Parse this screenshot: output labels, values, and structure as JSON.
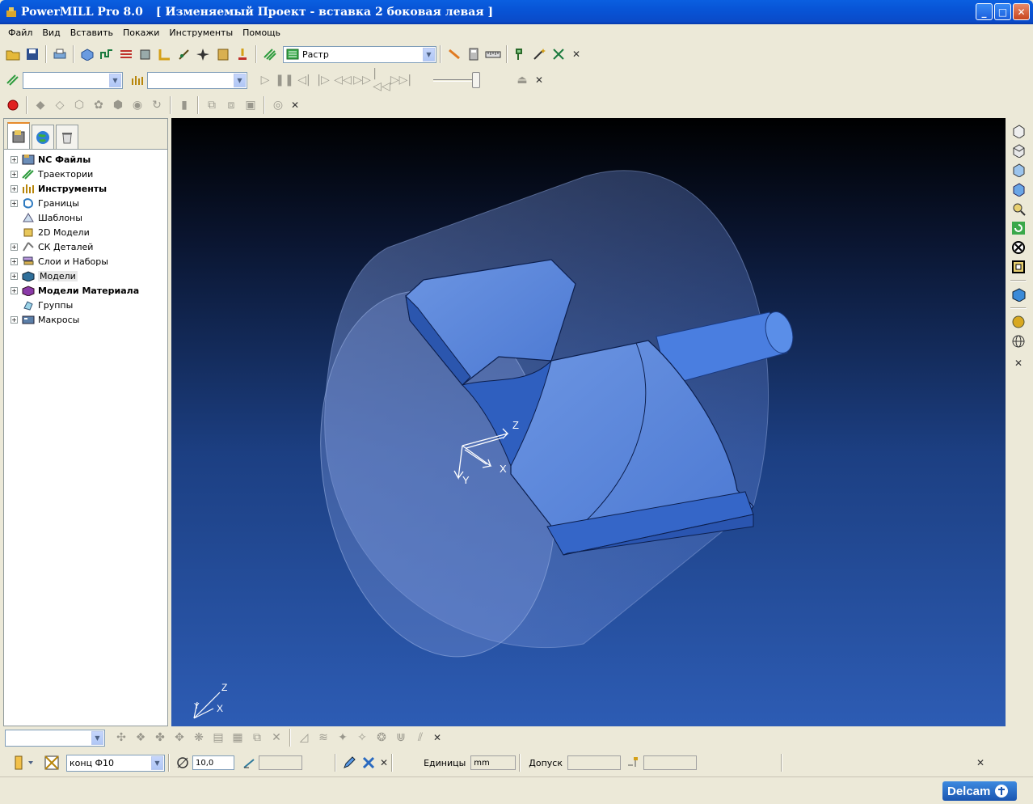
{
  "window": {
    "app_name": "PowerMILL Pro 8.0",
    "project": "[ Изменяемый Проект - вставка 2 боковая левая ]"
  },
  "menu": [
    "Файл",
    "Вид",
    "Вставить",
    "Покажи",
    "Инструменты",
    "Помощь"
  ],
  "toolbar": {
    "strategy_select": "Растр"
  },
  "explorer": {
    "items": [
      {
        "label": "NC Файлы",
        "bold": true,
        "expand": true
      },
      {
        "label": "Траектории",
        "bold": false,
        "expand": true
      },
      {
        "label": "Инструменты",
        "bold": true,
        "expand": true
      },
      {
        "label": "Границы",
        "bold": false,
        "expand": true
      },
      {
        "label": "Шаблоны",
        "bold": false,
        "expand": false
      },
      {
        "label": "2D Модели",
        "bold": false,
        "expand": false
      },
      {
        "label": "СК Деталей",
        "bold": false,
        "expand": true
      },
      {
        "label": "Слои и Наборы",
        "bold": false,
        "expand": true
      },
      {
        "label": "Модели",
        "bold": false,
        "expand": true,
        "highlight": true
      },
      {
        "label": "Модели Материала",
        "bold": true,
        "expand": true
      },
      {
        "label": "Группы",
        "bold": false,
        "expand": false
      },
      {
        "label": "Макросы",
        "bold": false,
        "expand": true
      }
    ]
  },
  "viewport": {
    "axis_main": {
      "x": "X",
      "y": "Y",
      "z": "Z"
    },
    "axis_corner": {
      "x": "X",
      "y": "Y",
      "z": "Z"
    }
  },
  "tool_bar": {
    "tool_name": "конц Ф10",
    "diameter": "10,0",
    "units_label": "Единицы",
    "units_value": "mm",
    "tolerance_label": "Допуск"
  },
  "brand": "Delcam"
}
